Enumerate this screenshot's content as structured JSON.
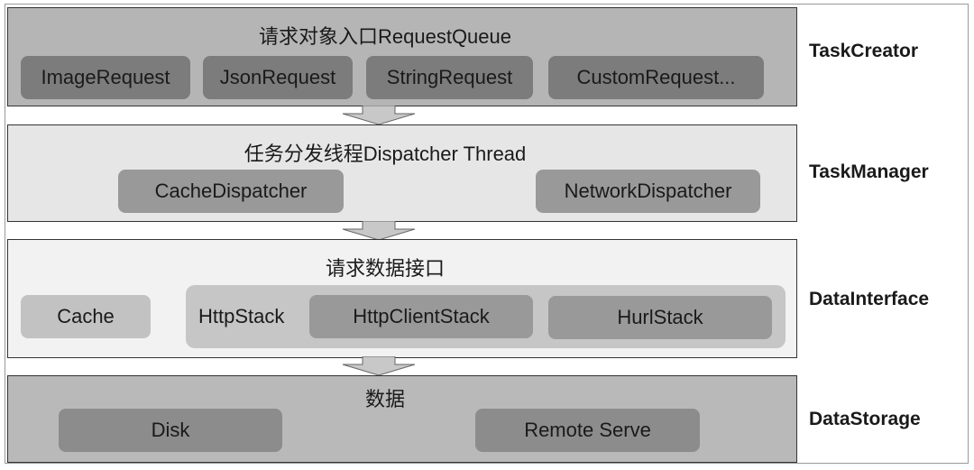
{
  "layers": [
    {
      "title": "请求对象入口RequestQueue",
      "side_label": "TaskCreator",
      "items": [
        "ImageRequest",
        "JsonRequest",
        "StringRequest",
        "CustomRequest..."
      ]
    },
    {
      "title": "任务分发线程Dispatcher Thread",
      "side_label": "TaskManager",
      "items": [
        "CacheDispatcher",
        "NetworkDispatcher"
      ]
    },
    {
      "title": "请求数据接口",
      "side_label": "DataInterface",
      "cache": "Cache",
      "group_label": "HttpStack",
      "items": [
        "HttpClientStack",
        "HurlStack"
      ]
    },
    {
      "title": "数据",
      "side_label": "DataStorage",
      "items": [
        "Disk",
        "Remote Serve"
      ]
    }
  ],
  "colors": {
    "layer1": "#b5b5b5",
    "layer2": "#e6e6e6",
    "layer3": "#f2f2f2",
    "layer4": "#b9b9b9",
    "pill_dark": "#7c7c7c",
    "pill_mid": "#999999"
  }
}
